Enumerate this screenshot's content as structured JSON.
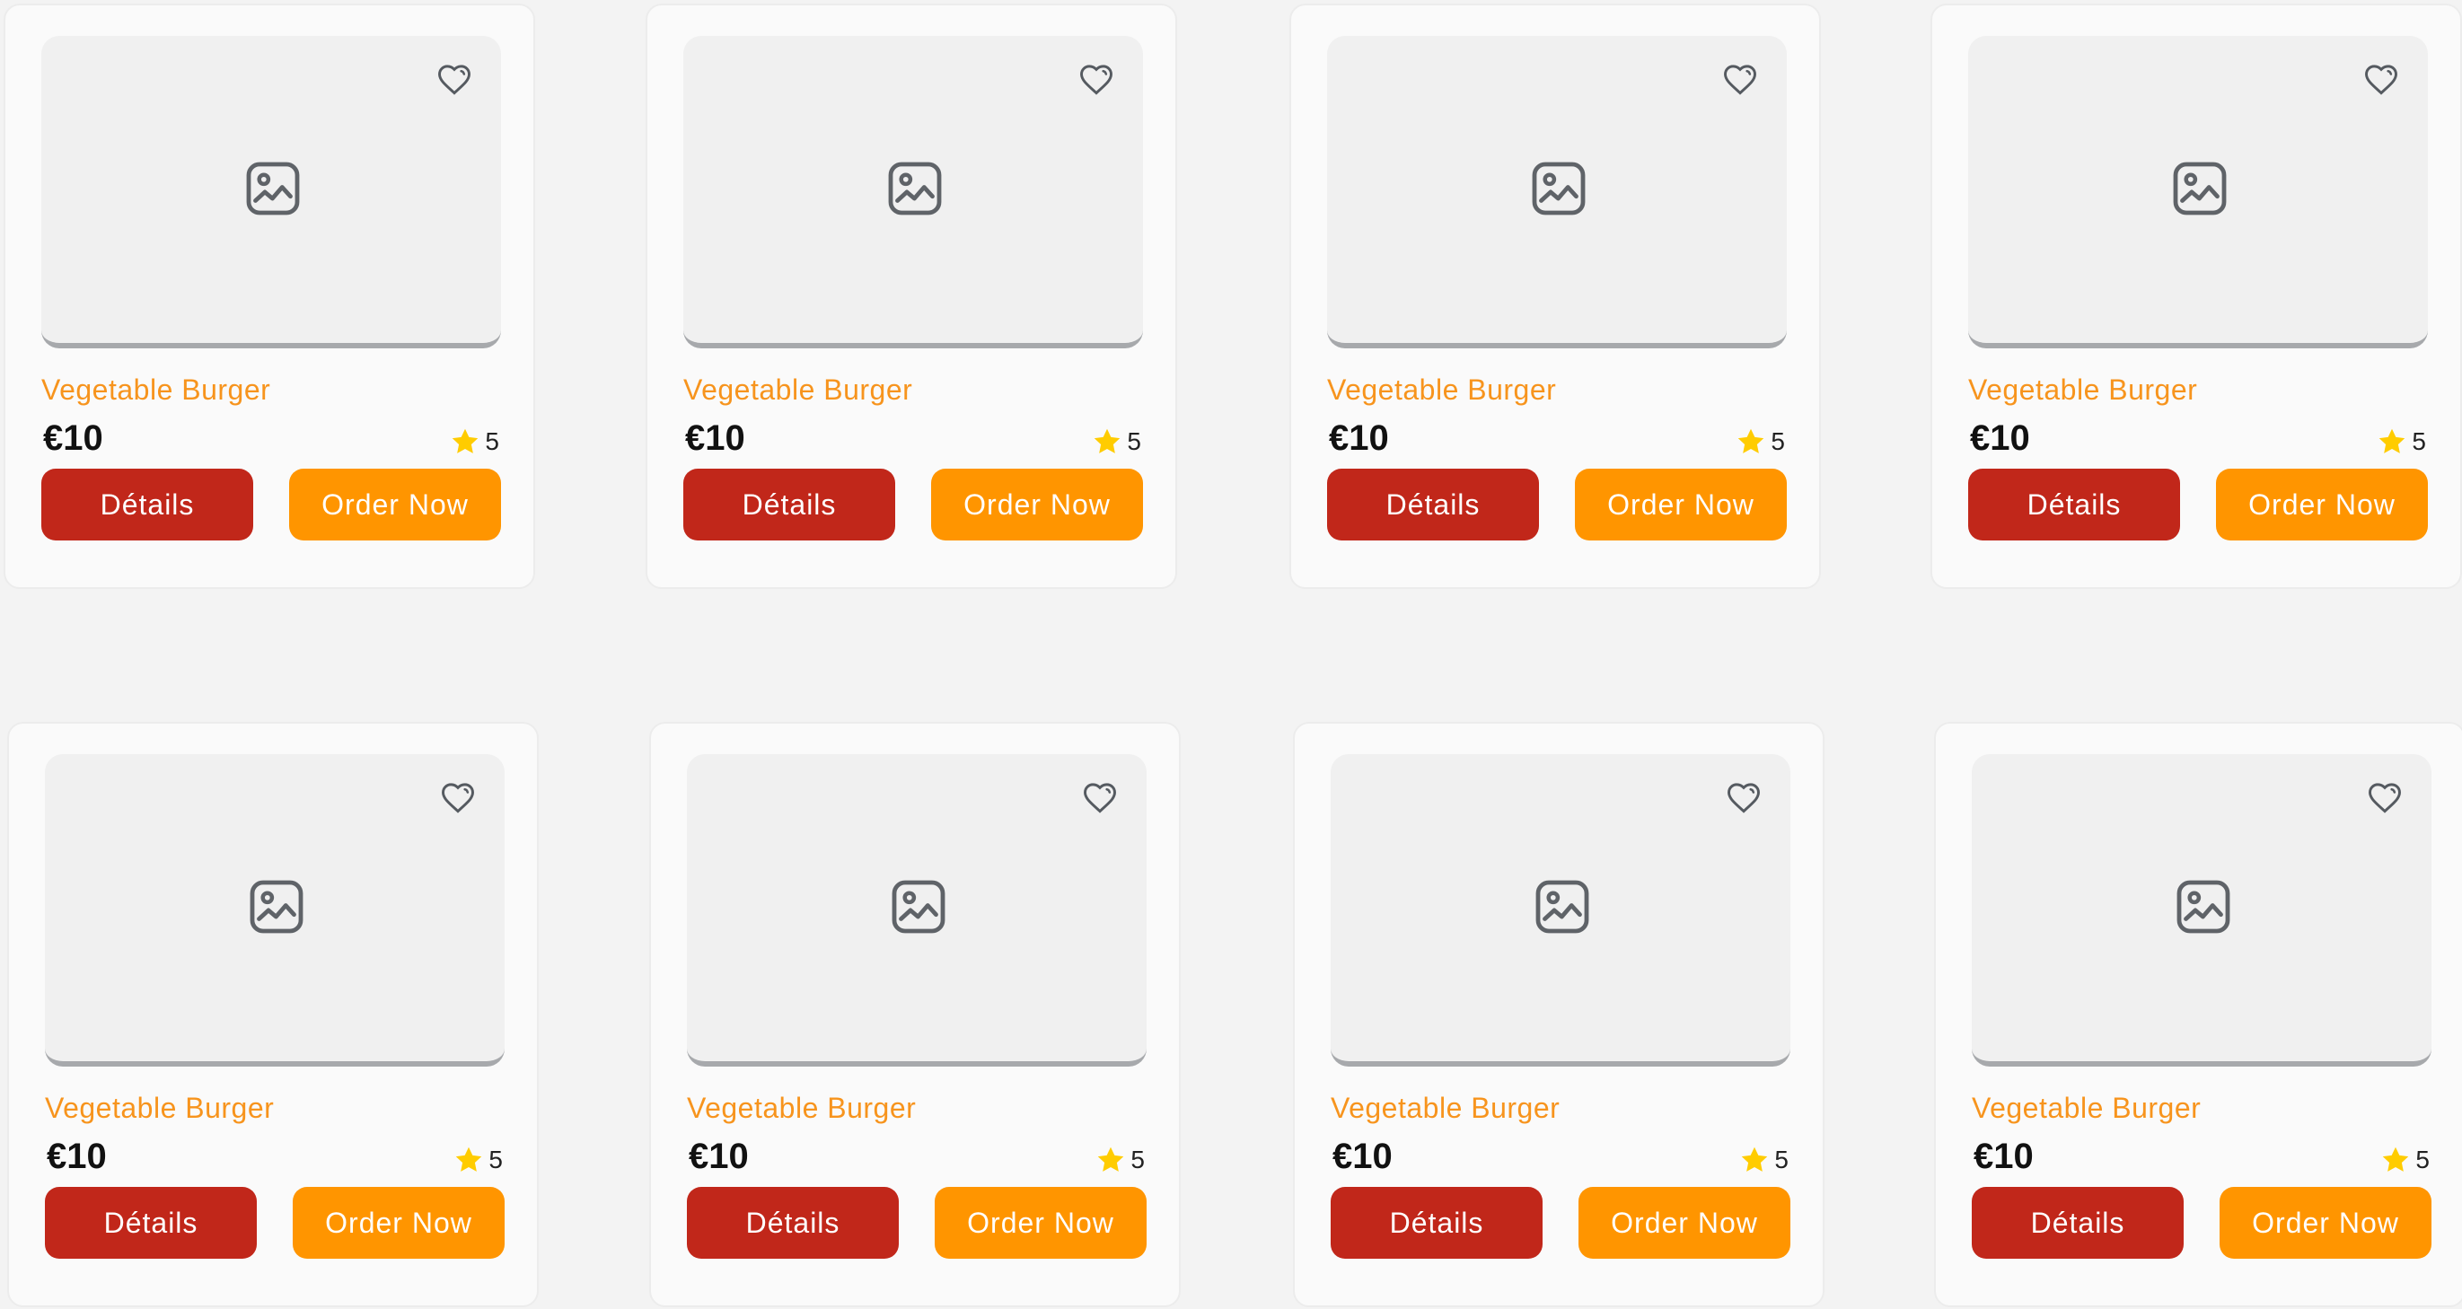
{
  "colors": {
    "accent_orange": "#ff9500",
    "name_orange": "#f7941d",
    "details_red": "#c1271a",
    "star_yellow": "#ffcc00"
  },
  "icons": {
    "favorite": "heart-icon",
    "placeholder": "image-icon",
    "rating": "star-icon"
  },
  "products": [
    {
      "name": "Vegetable Burger",
      "price": "€10",
      "rating": "5",
      "details_label": "Détails",
      "order_label": "Order Now"
    },
    {
      "name": "Vegetable Burger",
      "price": "€10",
      "rating": "5",
      "details_label": "Détails",
      "order_label": "Order Now"
    },
    {
      "name": "Vegetable Burger",
      "price": "€10",
      "rating": "5",
      "details_label": "Détails",
      "order_label": "Order Now"
    },
    {
      "name": "Vegetable Burger",
      "price": "€10",
      "rating": "5",
      "details_label": "Détails",
      "order_label": "Order Now"
    },
    {
      "name": "Vegetable Burger",
      "price": "€10",
      "rating": "5",
      "details_label": "Détails",
      "order_label": "Order Now"
    },
    {
      "name": "Vegetable Burger",
      "price": "€10",
      "rating": "5",
      "details_label": "Détails",
      "order_label": "Order Now"
    },
    {
      "name": "Vegetable Burger",
      "price": "€10",
      "rating": "5",
      "details_label": "Détails",
      "order_label": "Order Now"
    },
    {
      "name": "Vegetable Burger",
      "price": "€10",
      "rating": "5",
      "details_label": "Détails",
      "order_label": "Order Now"
    }
  ]
}
